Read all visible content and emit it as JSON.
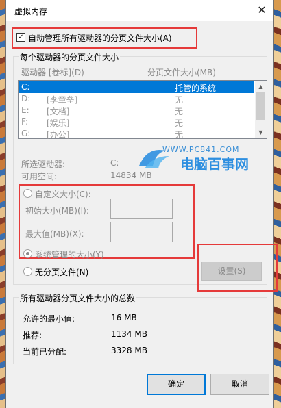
{
  "window": {
    "title": "虚拟内存",
    "close_glyph": "✕"
  },
  "auto_manage": {
    "label": "自动管理所有驱动器的分页文件大小(A)",
    "checked": true
  },
  "group_drives": {
    "label": "每个驱动器的分页文件大小",
    "col_drive": "驱动器 [卷标](D)",
    "col_size": "分页文件大小(MB)",
    "drives": [
      {
        "letter": "C:",
        "label": "",
        "size": "托管的系统",
        "selected": true
      },
      {
        "letter": "D:",
        "label": "[李章垒]",
        "size": "无",
        "selected": false
      },
      {
        "letter": "E:",
        "label": "[文档]",
        "size": "无",
        "selected": false
      },
      {
        "letter": "F:",
        "label": "[娱乐]",
        "size": "无",
        "selected": false
      },
      {
        "letter": "G:",
        "label": "[办公]",
        "size": "无",
        "selected": false
      }
    ],
    "selected_drive_label": "所选驱动器:",
    "selected_drive_value": "C:",
    "available_label": "可用空间:",
    "available_value": "14834 MB",
    "custom_size_label": "自定义大小(C):",
    "initial_size_label": "初始大小(MB)(I):",
    "initial_size_value": "",
    "max_size_label": "最大值(MB)(X):",
    "max_size_value": "",
    "system_managed_label": "系统管理的大小(Y)",
    "no_paging_label": "无分页文件(N)",
    "set_button": "设置(S)",
    "selected_option": "system_managed"
  },
  "watermark": {
    "url": "WWW.PC841.COM",
    "text": "电脑百事网"
  },
  "group_totals": {
    "label": "所有驱动器分页文件大小的总数",
    "min_label": "允许的最小值:",
    "min_value": "16 MB",
    "recommended_label": "推荐:",
    "recommended_value": "1134 MB",
    "allocated_label": "当前已分配:",
    "allocated_value": "3328 MB"
  },
  "buttons": {
    "ok": "确定",
    "cancel": "取消"
  },
  "colors": {
    "highlight_red": "#e53a3a",
    "selection_blue": "#0078d7"
  }
}
